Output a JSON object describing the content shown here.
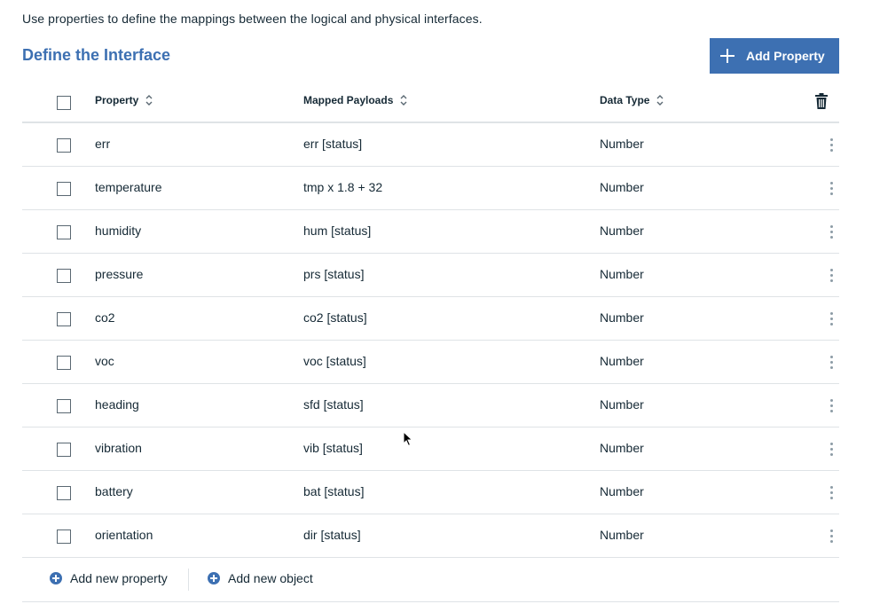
{
  "intro_text": "Use properties to define the mappings between the logical and physical interfaces.",
  "section_title": "Define the Interface",
  "add_property_button": {
    "label": "Add Property",
    "icon": "plus-icon"
  },
  "table": {
    "columns": [
      {
        "label": "Property",
        "icon": "sort-icon"
      },
      {
        "label": "Mapped Payloads",
        "icon": "sort-icon"
      },
      {
        "label": "Data Type",
        "icon": "sort-icon"
      }
    ],
    "header_action_icon": "trash-icon",
    "row_action_icon": "overflow-menu-icon",
    "rows": [
      {
        "property": "err",
        "mapped_payload": "err [status]",
        "data_type": "Number"
      },
      {
        "property": "temperature",
        "mapped_payload": "tmp x 1.8 + 32",
        "data_type": "Number"
      },
      {
        "property": "humidity",
        "mapped_payload": "hum [status]",
        "data_type": "Number"
      },
      {
        "property": "pressure",
        "mapped_payload": "prs [status]",
        "data_type": "Number"
      },
      {
        "property": "co2",
        "mapped_payload": "co2 [status]",
        "data_type": "Number"
      },
      {
        "property": "voc",
        "mapped_payload": "voc [status]",
        "data_type": "Number"
      },
      {
        "property": "heading",
        "mapped_payload": "sfd [status]",
        "data_type": "Number"
      },
      {
        "property": "vibration",
        "mapped_payload": "vib [status]",
        "data_type": "Number"
      },
      {
        "property": "battery",
        "mapped_payload": "bat [status]",
        "data_type": "Number"
      },
      {
        "property": "orientation",
        "mapped_payload": "dir [status]",
        "data_type": "Number"
      }
    ]
  },
  "footer": {
    "add_new_property": "Add new property",
    "add_new_object": "Add new object"
  },
  "colors": {
    "accent": "#3d70b2",
    "text": "#152935",
    "border": "#dfe3e6",
    "muted_icon": "#8c9ba5"
  }
}
